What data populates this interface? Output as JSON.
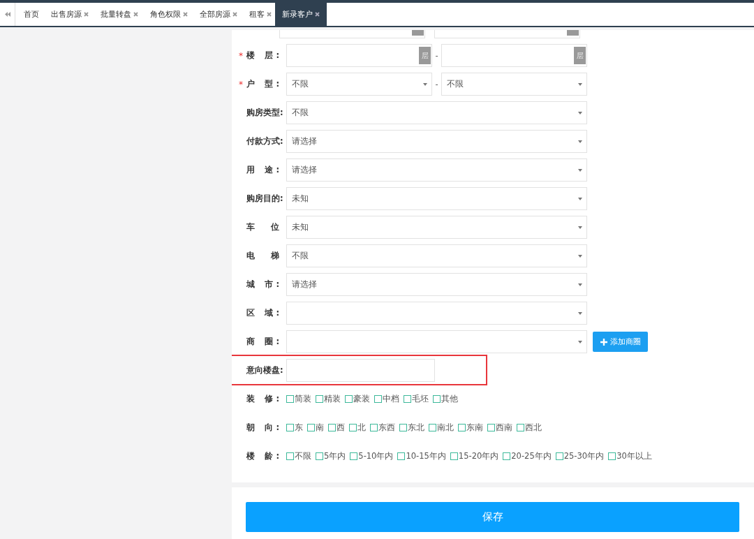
{
  "tabs": [
    {
      "label": "首页",
      "closable": false,
      "selected": false
    },
    {
      "label": "出售房源",
      "closable": true,
      "selected": false
    },
    {
      "label": "批量转盘",
      "closable": true,
      "selected": false
    },
    {
      "label": "角色权限",
      "closable": true,
      "selected": false
    },
    {
      "label": "全部房源",
      "closable": true,
      "selected": false
    },
    {
      "label": "租客",
      "closable": true,
      "selected": false
    },
    {
      "label": "新录客户",
      "closable": true,
      "selected": true
    }
  ],
  "form": {
    "fields": [
      {
        "kind": "cropped-range"
      },
      {
        "kind": "range-unit",
        "label": "楼 层:",
        "required_mark": "*",
        "unit": "层",
        "unit_2": "层",
        "separator": "-"
      },
      {
        "kind": "range-select",
        "label": "户 型:",
        "required_mark": "*",
        "value": "不限",
        "value_2": "不限",
        "separator": "-"
      },
      {
        "kind": "select",
        "label": "购房类型:",
        "value": "不限"
      },
      {
        "kind": "select",
        "label": "付款方式:",
        "value": "请选择"
      },
      {
        "kind": "select",
        "label": "用 途:",
        "value": "请选择"
      },
      {
        "kind": "select",
        "label": "购房目的:",
        "value": "未知"
      },
      {
        "kind": "select",
        "label": "车 位",
        "value": "未知"
      },
      {
        "kind": "select",
        "label": "电 梯",
        "value": "不限"
      },
      {
        "kind": "select",
        "label": "城 市:",
        "value": "请选择"
      },
      {
        "kind": "select",
        "label": "区 域:"
      },
      {
        "kind": "select-button",
        "label": "商 圈:",
        "button": "添加商圈"
      },
      {
        "kind": "text",
        "label": "意向楼盘:",
        "highlighted": true
      },
      {
        "kind": "checks",
        "label": "装 修:",
        "options": [
          {
            "label": "简装",
            "checked": false
          },
          {
            "label": "精装",
            "checked": false
          },
          {
            "label": "豪装",
            "checked": false
          },
          {
            "label": "中档",
            "checked": false
          },
          {
            "label": "毛坯",
            "checked": false
          },
          {
            "label": "其他",
            "checked": false
          }
        ]
      },
      {
        "kind": "checks",
        "label": "朝 向:",
        "options": [
          {
            "label": "东",
            "checked": false
          },
          {
            "label": "南",
            "checked": false
          },
          {
            "label": "西",
            "checked": false
          },
          {
            "label": "北",
            "checked": false
          },
          {
            "label": "东西",
            "checked": false
          },
          {
            "label": "东北",
            "checked": false
          },
          {
            "label": "南北",
            "checked": false
          },
          {
            "label": "东南",
            "checked": false
          },
          {
            "label": "西南",
            "checked": false
          },
          {
            "label": "西北",
            "checked": false
          }
        ]
      },
      {
        "kind": "checks",
        "label": "楼 龄:",
        "options": [
          {
            "label": "不限",
            "checked": false
          },
          {
            "label": "5年内",
            "checked": false
          },
          {
            "label": "5-10年内",
            "checked": false
          },
          {
            "label": "10-15年内",
            "checked": false
          },
          {
            "label": "15-20年内",
            "checked": false
          },
          {
            "label": "20-25年内",
            "checked": false
          },
          {
            "label": "25-30年内",
            "checked": false
          },
          {
            "label": "30年以上",
            "checked": false
          }
        ]
      }
    ]
  },
  "save_button": "保存"
}
